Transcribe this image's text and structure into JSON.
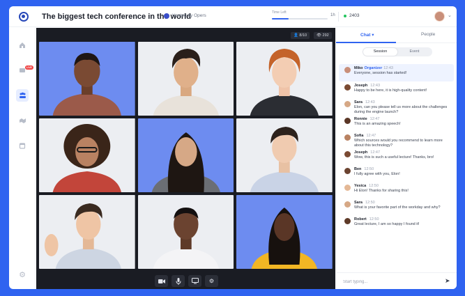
{
  "header": {
    "title": "The biggest tech conference in the world",
    "host": "Hosted by Opers",
    "time_left_label": "Time Left",
    "time_progress": 0.3,
    "time_end": "1h",
    "viewers": "2403"
  },
  "sidebar": {
    "items": [
      {
        "icon": "home-icon"
      },
      {
        "icon": "live-video-icon",
        "badge": "LIVE"
      },
      {
        "icon": "attendees-icon"
      },
      {
        "icon": "handshake-icon"
      },
      {
        "icon": "calendar-icon"
      }
    ],
    "settings_icon": "settings-icon"
  },
  "stage": {
    "participants": "8/10",
    "views": "292"
  },
  "chat": {
    "tabs": [
      "Chat",
      "People"
    ],
    "segments": [
      "Session",
      "Event"
    ],
    "messages": [
      {
        "name": "Miko",
        "role": "Organizer",
        "time": "12:43",
        "text": "Everyone, session has started!",
        "highlight": true
      },
      {
        "name": "Joseph",
        "role": "",
        "time": "12:43",
        "text": "Happy to be here, it is high-quality content!"
      },
      {
        "name": "Sara",
        "role": "",
        "time": "12:43",
        "text": "Elon, can you please tell us more about the challenges during the engine launch?"
      },
      {
        "name": "Ronnie",
        "role": "",
        "time": "12:47",
        "text": "This is an amazing speech!"
      },
      {
        "name": "Sofia",
        "role": "",
        "time": "12:47",
        "text": "Which sources would you recommend to learn more about this technology?"
      },
      {
        "name": "Joseph",
        "role": "",
        "time": "12:47",
        "text": "Wow, this is such a useful lecture! Thanks, bro!"
      },
      {
        "name": "Ben",
        "role": "",
        "time": "12:50",
        "text": "I fully agree with you, Elon!"
      },
      {
        "name": "Yesica",
        "role": "",
        "time": "12:50",
        "text": "Hi Elon! Thanks for sharing this!"
      },
      {
        "name": "Sara",
        "role": "",
        "time": "12:50",
        "text": "What is your favorite part of the workday and why?"
      },
      {
        "name": "Robert",
        "role": "",
        "time": "12:50",
        "text": "Great lecture, I am so happy I found it!"
      }
    ],
    "placeholder": "Start typing..."
  },
  "colors": {
    "accent": "#2f63f0",
    "organizer": "#2f63f0",
    "live": "#ef4444"
  }
}
